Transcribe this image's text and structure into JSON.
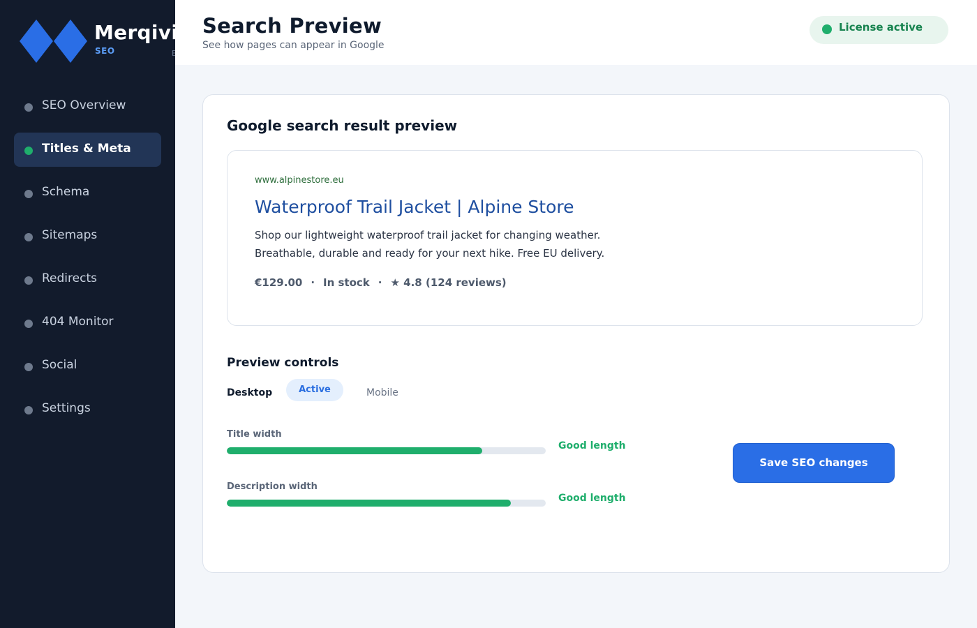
{
  "brand": {
    "name": "Merqivi",
    "subtitle": "SEO",
    "subtitle_secondary": "E",
    "accent_color": "#2a6ee6"
  },
  "sidebar": {
    "items": [
      {
        "label": "SEO Overview",
        "active": false
      },
      {
        "label": "Titles & Meta",
        "active": true
      },
      {
        "label": "Schema",
        "active": false
      },
      {
        "label": "Sitemaps",
        "active": false
      },
      {
        "label": "Redirects",
        "active": false
      },
      {
        "label": "404 Monitor",
        "active": false
      },
      {
        "label": "Social",
        "active": false
      },
      {
        "label": "Settings",
        "active": false
      }
    ]
  },
  "header": {
    "title": "Search Preview",
    "subtitle": "See how pages can appear in Google",
    "license_status": "License active",
    "license_color": "#1fae6c"
  },
  "preview_card": {
    "title": "Google search result preview",
    "result": {
      "url": "www.alpinestore.eu",
      "title": "Waterproof Trail Jacket | Alpine Store",
      "description_line1": "Shop our lightweight waterproof trail jacket for changing weather.",
      "description_line2": "Breathable, durable and ready for your next hike. Free EU delivery.",
      "price": "€129.00",
      "stock": "In stock",
      "rating": "★ 4.8 (124 reviews)",
      "separator": "·"
    }
  },
  "controls": {
    "title": "Preview controls",
    "device_label": "Desktop",
    "active_badge": "Active",
    "alt_device": "Mobile",
    "meters": [
      {
        "label": "Title width",
        "status": "Good length",
        "fill_fraction": 0.8
      },
      {
        "label": "Description width",
        "status": "Good length",
        "fill_fraction": 0.89
      }
    ]
  },
  "actions": {
    "save_label": "Save SEO changes"
  }
}
